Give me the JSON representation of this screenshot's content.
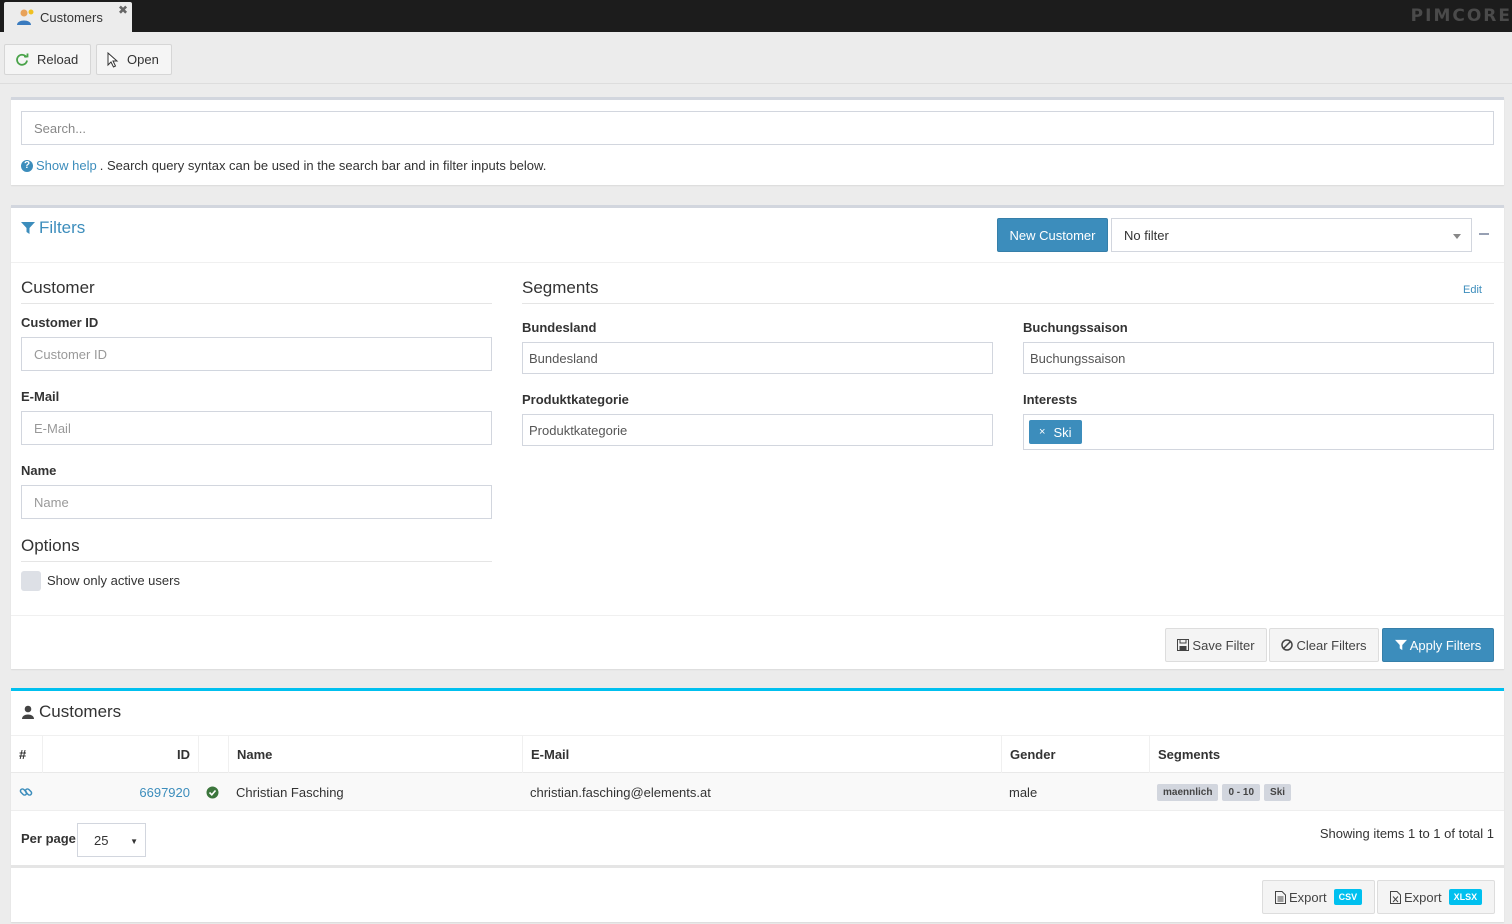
{
  "app": {
    "tab_title": "Customers",
    "brand": "PIMCORE"
  },
  "toolbar": {
    "reload_label": "Reload",
    "open_label": "Open"
  },
  "search": {
    "placeholder": "Search...",
    "help_link": "Show help",
    "help_text": ". Search query syntax can be used in the search bar and in filter inputs below."
  },
  "filters": {
    "title": "Filters",
    "new_customer_label": "New Customer",
    "saved_filter_value": "No filter",
    "customer_section": "Customer",
    "customer_id_label": "Customer ID",
    "customer_id_placeholder": "Customer ID",
    "email_label": "E-Mail",
    "email_placeholder": "E-Mail",
    "name_label": "Name",
    "name_placeholder": "Name",
    "options_section": "Options",
    "active_only_label": "Show only active users",
    "segments_section": "Segments",
    "edit_label": "Edit",
    "bundesland_label": "Bundesland",
    "bundesland_placeholder": "Bundesland",
    "buchungssaison_label": "Buchungssaison",
    "buchungssaison_placeholder": "Buchungssaison",
    "produktkategorie_label": "Produktkategorie",
    "produktkategorie_placeholder": "Produktkategorie",
    "interests_label": "Interests",
    "interests_tags": [
      "Ski"
    ],
    "save_filter_label": "Save Filter",
    "clear_filters_label": "Clear Filters",
    "apply_filters_label": "Apply Filters"
  },
  "customers": {
    "title": "Customers",
    "columns": [
      "#",
      "ID",
      "Name",
      "E-Mail",
      "Gender",
      "Segments"
    ],
    "rows": [
      {
        "id": "6697920",
        "active": true,
        "name": "Christian Fasching",
        "email": "christian.fasching@elements.at",
        "gender": "male",
        "segments": [
          "maennlich",
          "0 - 10",
          "Ski"
        ]
      }
    ],
    "per_page_label": "Per page",
    "per_page_value": "25",
    "showing_text": "Showing items 1 to 1 of total 1",
    "export_label": "Export",
    "export_csv_badge": "CSV",
    "export_xlsx_badge": "XLSX"
  },
  "colors": {
    "primary": "#3c8dbc",
    "info": "#00c0ef",
    "success": "#3c763d",
    "topbar": "#1c1c1c"
  }
}
